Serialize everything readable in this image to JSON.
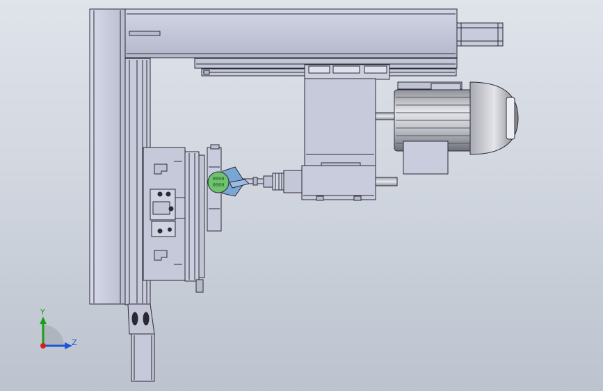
{
  "viewport": {
    "background_top": "#dfe3ea",
    "background_bottom": "#bcc3ce",
    "part_fill": "#c9ccdc",
    "part_edge": "#2a2a35"
  },
  "model": {
    "components": [
      "left-column-frame",
      "top-linear-rail",
      "rail-servo-motor",
      "rail-carriage",
      "spindle-head-block",
      "drive-motor",
      "motor-terminal-box",
      "spindle-nose",
      "tool-holder",
      "rotary-fixture-plate",
      "fixture-clamp-block",
      "workpiece-disc",
      "base-leg",
      "leg-bracket"
    ],
    "workpiece_label_lines": [
      "0000",
      "0000"
    ],
    "workpiece_color": "#6fc36f",
    "workpiece_holder_color": "#7aa6d6"
  },
  "triad": {
    "y_label": "Y",
    "z_label": "Z",
    "y_color": "#1a9e1a",
    "z_color": "#1a56d6",
    "origin_color": "#d62020"
  }
}
